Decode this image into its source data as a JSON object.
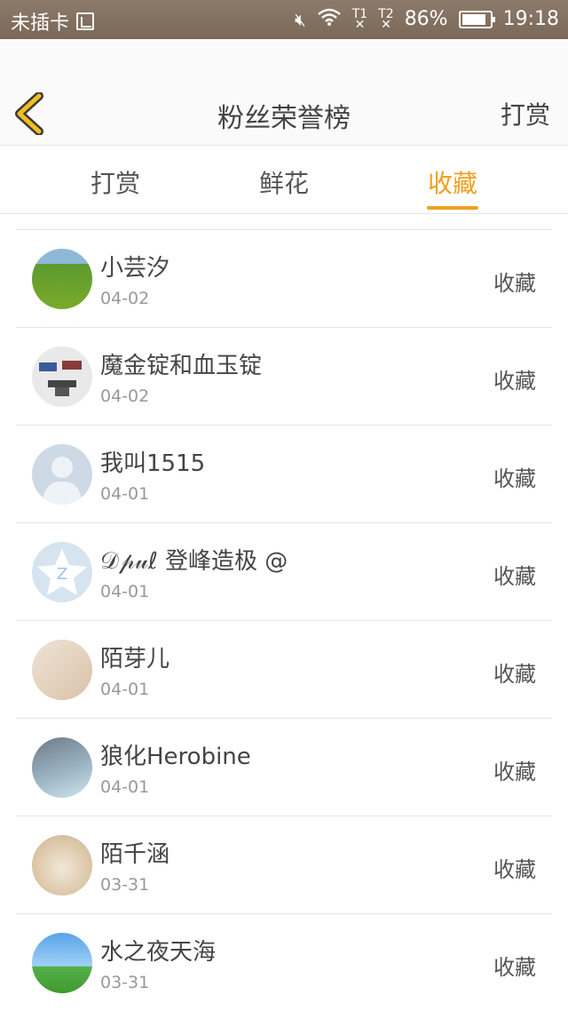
{
  "status_bar": {
    "carrier": "未插卡",
    "signal1": "T1",
    "signal2": "T2",
    "battery_percent": "86%",
    "battery_level": 0.86,
    "time": "19:18"
  },
  "header": {
    "title": "粉丝荣誉榜",
    "action_label": "打赏"
  },
  "tabs": [
    {
      "label": "打赏"
    },
    {
      "label": "鲜花"
    },
    {
      "label": "收藏",
      "active": true
    }
  ],
  "list": [
    {
      "name": "小芸汐",
      "date": "04-02",
      "action": "收藏"
    },
    {
      "name": "魔金锭和血玉锭",
      "date": "04-02",
      "action": "收藏"
    },
    {
      "name": "我叫1515",
      "date": "04-01",
      "action": "收藏"
    },
    {
      "name": "𝒟𝓅𝓊ℓ 登峰造极 @",
      "date": "04-01",
      "action": "收藏"
    },
    {
      "name": "陌芽儿",
      "date": "04-01",
      "action": "收藏"
    },
    {
      "name": "狼化Herobine",
      "date": "04-01",
      "action": "收藏"
    },
    {
      "name": "陌千涵",
      "date": "03-31",
      "action": "收藏"
    },
    {
      "name": "水之夜天海",
      "date": "03-31",
      "action": "收藏"
    }
  ],
  "colors": {
    "accent": "#f0a020",
    "back_icon": "#f0c020"
  }
}
